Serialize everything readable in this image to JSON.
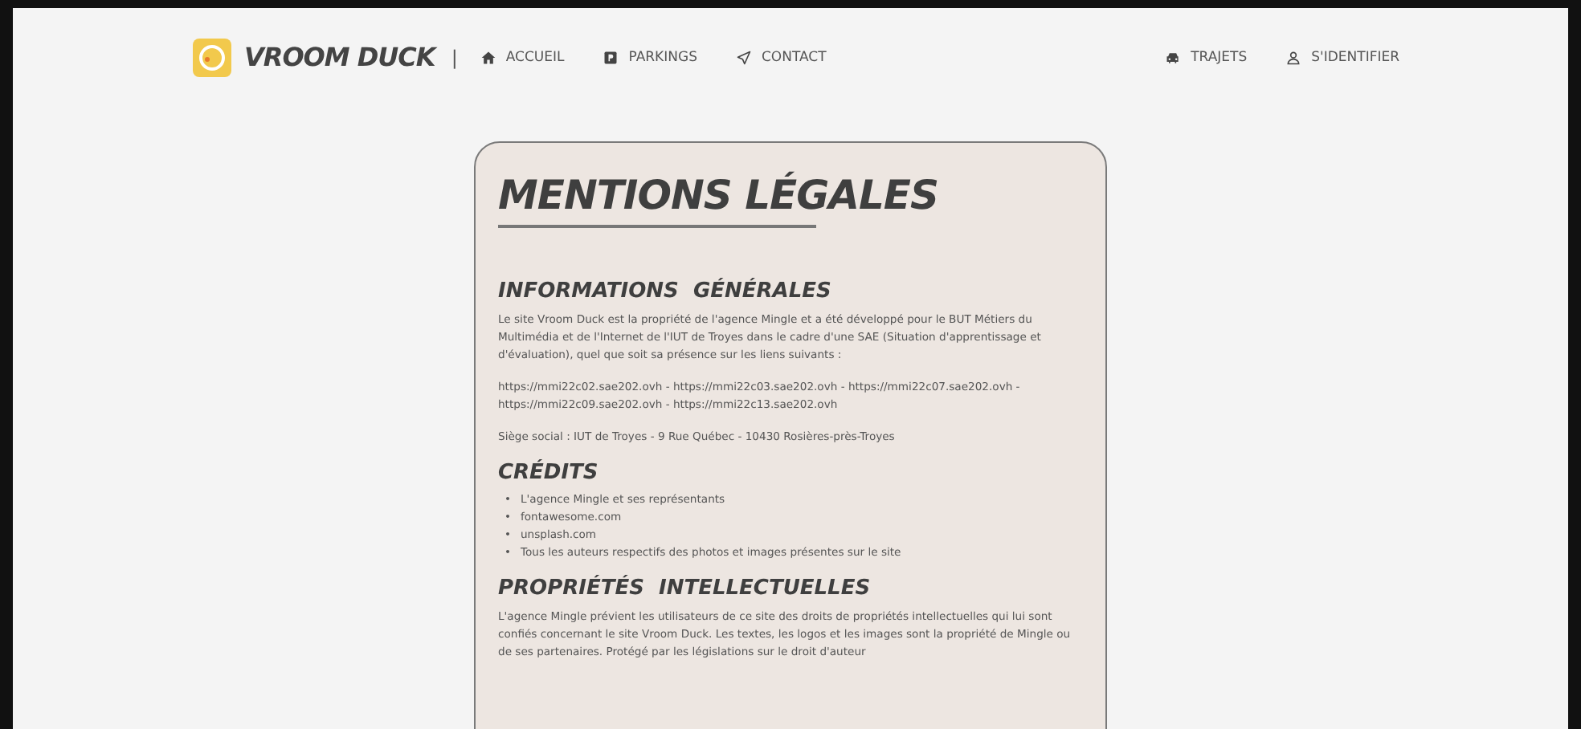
{
  "navbar": {
    "brand": "VROOM DUCK",
    "separator": "|",
    "left_links": [
      {
        "label": "ACCUEIL"
      },
      {
        "label": "PARKINGS"
      },
      {
        "label": "CONTACT"
      }
    ],
    "right_links": [
      {
        "label": "TRAJETS"
      },
      {
        "label": "S'IDENTIFIER"
      }
    ]
  },
  "card": {
    "title": "MENTIONS LÉGALES",
    "sections": [
      {
        "heading": "INFORMATIONS  GÉNÉRALES",
        "blocks": [
          {
            "kind": "paragraph",
            "text": "Le site Vroom Duck est la propriété de l'agence Mingle et a été développé pour le BUT Métiers du Multimédia et de l'Internet de l'IUT de Troyes dans le cadre d'une SAE (Situation d'apprentissage et d'évaluation), quel que soit sa présence sur les liens suivants :"
          },
          {
            "kind": "paragraph",
            "text": "https://mmi22c02.sae202.ovh - https://mmi22c03.sae202.ovh - https://mmi22c07.sae202.ovh - https://mmi22c09.sae202.ovh - https://mmi22c13.sae202.ovh"
          },
          {
            "kind": "paragraph",
            "text": "Siège social : IUT de Troyes - 9 Rue Québec - 10430 Rosières-près-Troyes"
          }
        ]
      },
      {
        "heading": "CRÉDITS",
        "blocks": [
          {
            "kind": "list",
            "marker": "•",
            "items": [
              "L'agence Mingle et ses représentants",
              "fontawesome.com",
              "unsplash.com",
              "Tous les auteurs respectifs des photos et images présentes sur le site"
            ]
          }
        ]
      },
      {
        "heading": "PROPRIÉTÉS  INTELLECTUELLES",
        "blocks": [
          {
            "kind": "paragraph",
            "text": "L'agence Mingle prévient les utilisateurs de ce site des droits de propriétés intellectuelles qui lui sont confiés concernant le site Vroom Duck. Les textes, les logos et les images sont la propriété de Mingle ou de ses partenaires. Protégé par les législations sur le droit d'auteur"
          }
        ]
      }
    ]
  }
}
